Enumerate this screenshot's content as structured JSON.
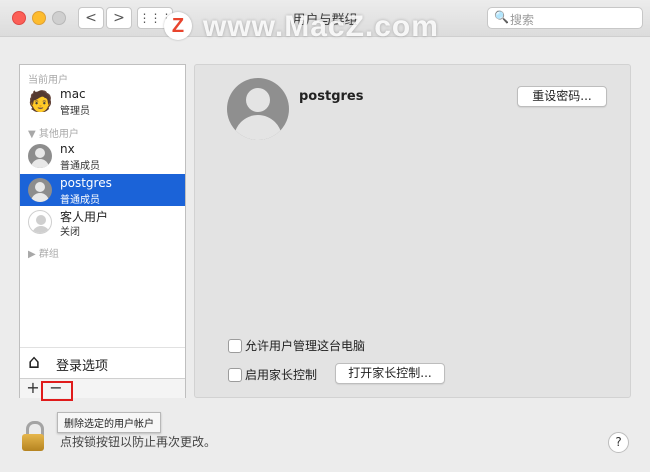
{
  "window": {
    "title": "用户与群组",
    "search_placeholder": "搜索",
    "back_glyph": "<",
    "forward_glyph": ">",
    "grid_glyph": "⋮⋮⋮",
    "search_glyph": "🔍"
  },
  "watermark": {
    "logo_letter": "Z",
    "text": "www.MacZ.com"
  },
  "sidebar": {
    "current_users_header": "当前用户",
    "other_users_header": "其他用户",
    "groups_header": "群组",
    "users": [
      {
        "name": "mac",
        "role": "管理员",
        "icon": "gingerbread-avatar-icon",
        "glyph": "🧑"
      },
      {
        "name": "nx",
        "role": "普通成员",
        "icon": "user-avatar-icon"
      },
      {
        "name": "postgres",
        "role": "普通成员",
        "icon": "user-avatar-icon",
        "selected": true
      },
      {
        "name": "客人用户",
        "role": "关闭",
        "icon": "guest-avatar-icon"
      }
    ],
    "login_options": "登录选项",
    "house_glyph": "⌂",
    "add_glyph": "+",
    "remove_glyph": "−"
  },
  "tooltip": "删除选定的用户帐户",
  "detail": {
    "username": "postgres",
    "reset_password_button": "重设密码...",
    "allow_admin_label": "允许用户管理这台电脑",
    "parental_controls_label": "启用家长控制",
    "open_parental_controls_button": "打开家长控制..."
  },
  "footer": {
    "lock_text": "点按锁按钮以防止再次更改。",
    "help_glyph": "?"
  },
  "colors": {
    "selection": "#1b63d8",
    "highlight_box": "#e01b1b",
    "watermark_logo": "#e8442d"
  }
}
